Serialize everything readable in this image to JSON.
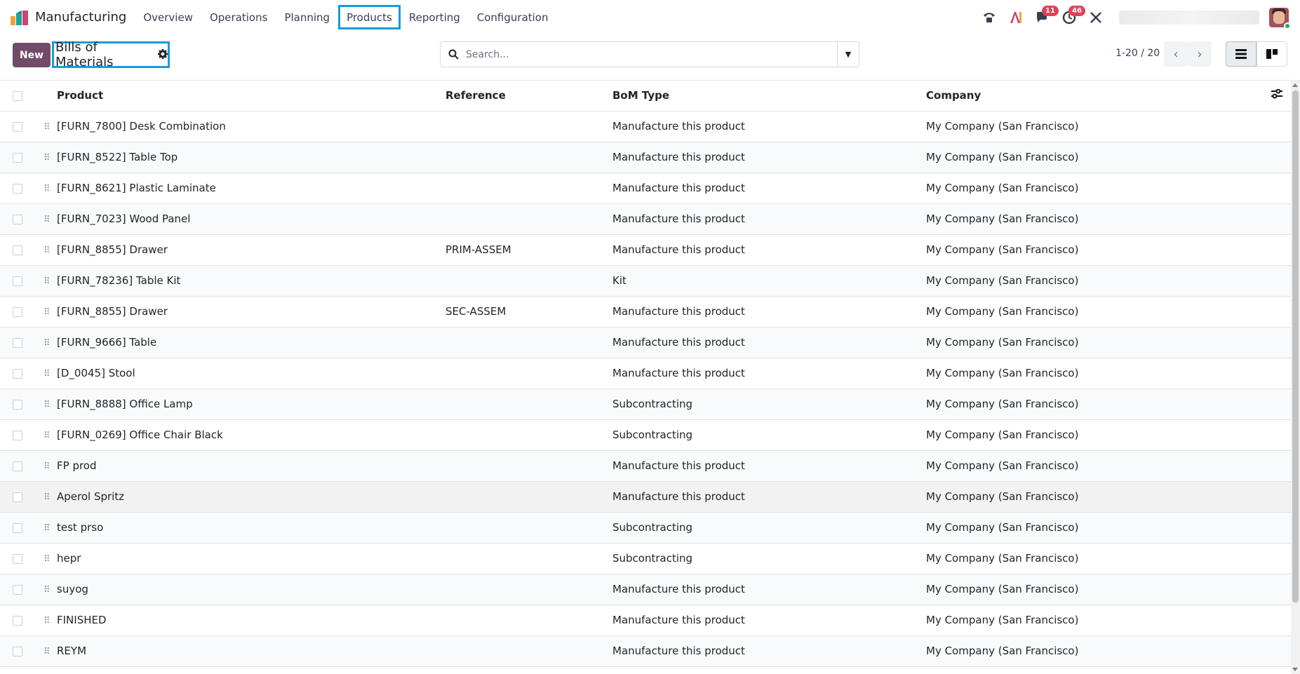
{
  "app": {
    "name": "Manufacturing",
    "menu": [
      "Overview",
      "Operations",
      "Planning",
      "Products",
      "Reporting",
      "Configuration"
    ],
    "active_menu": "Products"
  },
  "systray": {
    "messages_badge": "11",
    "activities_badge": "46"
  },
  "control_panel": {
    "new_label": "New",
    "breadcrumb_title": "Bills of Materials",
    "search_placeholder": "Search...",
    "pager": "1-20 / 20"
  },
  "table": {
    "columns": [
      "Product",
      "Reference",
      "BoM Type",
      "Company"
    ],
    "rows": [
      {
        "product": "[FURN_7800] Desk Combination",
        "reference": "",
        "bom_type": "Manufacture this product",
        "company": "My Company (San Francisco)"
      },
      {
        "product": "[FURN_8522] Table Top",
        "reference": "",
        "bom_type": "Manufacture this product",
        "company": "My Company (San Francisco)"
      },
      {
        "product": "[FURN_8621] Plastic Laminate",
        "reference": "",
        "bom_type": "Manufacture this product",
        "company": "My Company (San Francisco)"
      },
      {
        "product": "[FURN_7023] Wood Panel",
        "reference": "",
        "bom_type": "Manufacture this product",
        "company": "My Company (San Francisco)"
      },
      {
        "product": "[FURN_8855] Drawer",
        "reference": "PRIM-ASSEM",
        "bom_type": "Manufacture this product",
        "company": "My Company (San Francisco)"
      },
      {
        "product": "[FURN_78236] Table Kit",
        "reference": "",
        "bom_type": "Kit",
        "company": "My Company (San Francisco)"
      },
      {
        "product": "[FURN_8855] Drawer",
        "reference": "SEC-ASSEM",
        "bom_type": "Manufacture this product",
        "company": "My Company (San Francisco)"
      },
      {
        "product": "[FURN_9666] Table",
        "reference": "",
        "bom_type": "Manufacture this product",
        "company": "My Company (San Francisco)"
      },
      {
        "product": "[D_0045] Stool",
        "reference": "",
        "bom_type": "Manufacture this product",
        "company": "My Company (San Francisco)"
      },
      {
        "product": "[FURN_8888] Office Lamp",
        "reference": "",
        "bom_type": "Subcontracting",
        "company": "My Company (San Francisco)"
      },
      {
        "product": "[FURN_0269] Office Chair Black",
        "reference": "",
        "bom_type": "Subcontracting",
        "company": "My Company (San Francisco)"
      },
      {
        "product": "FP prod",
        "reference": "",
        "bom_type": "Manufacture this product",
        "company": "My Company (San Francisco)"
      },
      {
        "product": "Aperol Spritz",
        "reference": "",
        "bom_type": "Manufacture this product",
        "company": "My Company (San Francisco)"
      },
      {
        "product": "test prso",
        "reference": "",
        "bom_type": "Subcontracting",
        "company": "My Company (San Francisco)"
      },
      {
        "product": "hepr",
        "reference": "",
        "bom_type": "Subcontracting",
        "company": "My Company (San Francisco)"
      },
      {
        "product": "suyog",
        "reference": "",
        "bom_type": "Manufacture this product",
        "company": "My Company (San Francisco)"
      },
      {
        "product": "FINISHED",
        "reference": "",
        "bom_type": "Manufacture this product",
        "company": "My Company (San Francisco)"
      },
      {
        "product": "REYM",
        "reference": "",
        "bom_type": "Manufacture this product",
        "company": "My Company (San Francisco)"
      }
    ]
  },
  "colors": {
    "brand_primary": "#714b67",
    "highlight_outline": "#1a9bd7",
    "badge": "#e0415a"
  },
  "icons": [
    "phone-icon",
    "ai-icon",
    "chat-icon",
    "activity-clock-icon",
    "debug-tools-icon",
    "search-icon",
    "dropdown-caret-icon",
    "chevron-left-icon",
    "chevron-right-icon",
    "list-view-icon",
    "kanban-view-icon",
    "column-settings-icon",
    "drag-handle-icon",
    "gear-icon"
  ]
}
